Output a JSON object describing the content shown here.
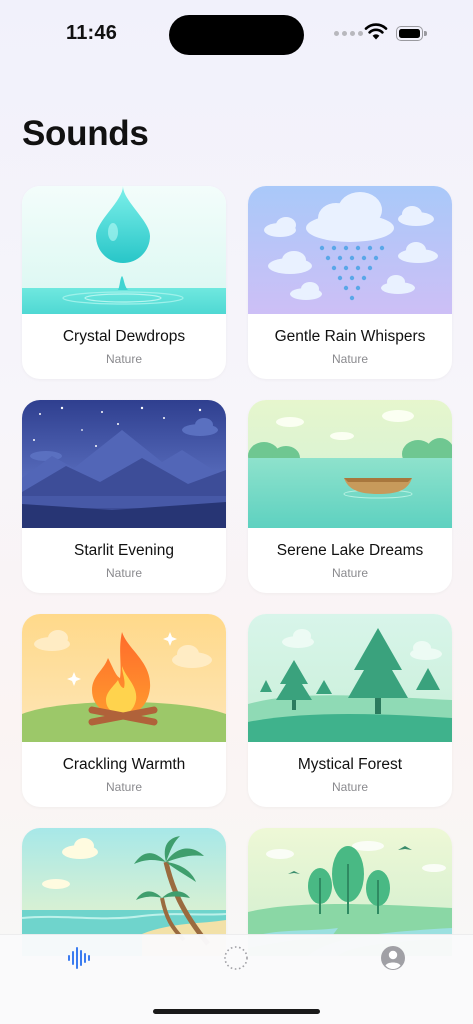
{
  "status_bar": {
    "time": "11:46"
  },
  "page_title": "Sounds",
  "cards": [
    {
      "title": "Crystal Dewdrops",
      "subtitle": "Nature",
      "icon": "water-drop-illustration"
    },
    {
      "title": "Gentle Rain Whispers",
      "subtitle": "Nature",
      "icon": "rain-cloud-illustration"
    },
    {
      "title": "Starlit Evening",
      "subtitle": "Nature",
      "icon": "night-mountains-illustration"
    },
    {
      "title": "Serene Lake Dreams",
      "subtitle": "Nature",
      "icon": "lake-boat-illustration"
    },
    {
      "title": "Crackling Warmth",
      "subtitle": "Nature",
      "icon": "campfire-illustration"
    },
    {
      "title": "Mystical Forest",
      "subtitle": "Nature",
      "icon": "forest-illustration"
    },
    {
      "icon": "palm-beach-illustration"
    },
    {
      "icon": "river-trees-illustration"
    }
  ],
  "tab_bar": {
    "items": [
      {
        "icon": "waveform-icon",
        "active": true
      },
      {
        "icon": "circle-dotted-icon",
        "active": false
      },
      {
        "icon": "person-circle-icon",
        "active": false
      }
    ]
  },
  "colors": {
    "accent": "#3b7cf0",
    "inactive": "#a0a0a5",
    "subtitle": "#8a8a8e"
  }
}
